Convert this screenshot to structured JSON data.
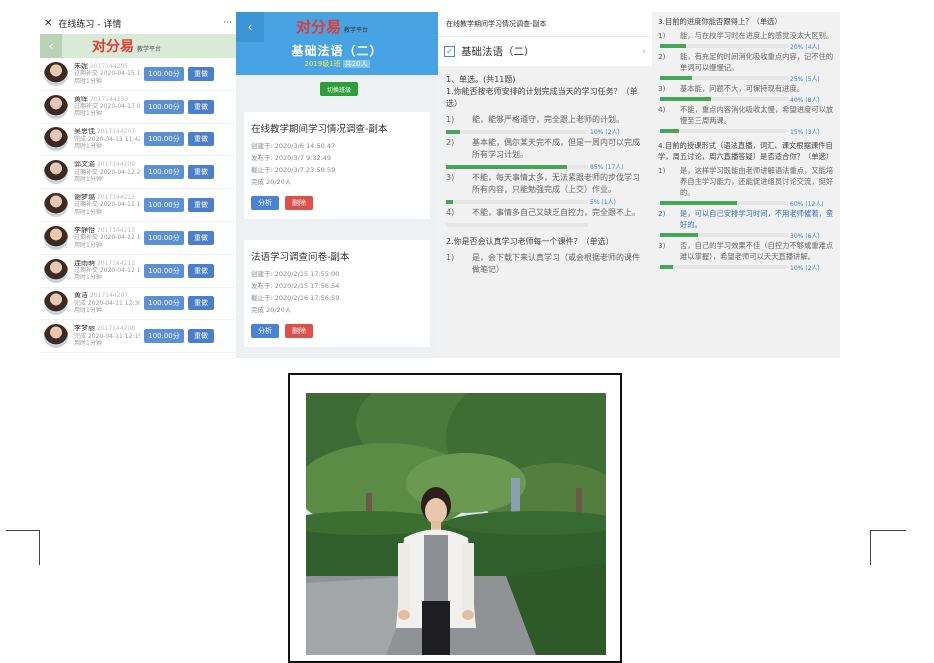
{
  "panel1": {
    "title": "在线练习 - 详情",
    "close": "✕",
    "more": "···",
    "back": "‹",
    "brand": "对分易",
    "brand_sub": "教学平台",
    "score_suffix": "分",
    "redo_label": "重做",
    "students": [
      {
        "name": "朱妮",
        "id": "2017144205",
        "line2": "过期补交 2020-04-15 10:25",
        "line3": "用时1分钟",
        "score": "100.00"
      },
      {
        "name": "黄晖",
        "id": "2017144203",
        "line2": "过期补交 2020-04-17 09:04",
        "line3": "用时1分钟",
        "score": "100.00"
      },
      {
        "name": "吴思佳",
        "id": "2017144207",
        "line2": "完成 2020-04-13 11:42",
        "line3": "用时1分钟",
        "score": "100.00"
      },
      {
        "name": "郭文渝",
        "id": "2017144209",
        "line2": "过期补交 2020-04-12 21:14",
        "line3": "用时1分钟",
        "score": "100.00"
      },
      {
        "name": "谢梦璐",
        "id": "2017144212",
        "line2": "过期补交 2020-04-11 12:11",
        "line3": "用时1分钟",
        "score": "100.00"
      },
      {
        "name": "李静怡",
        "id": "2017144213",
        "line2": "过期补交 2020-04-12 13:35",
        "line3": "用时1分钟",
        "score": "100.00"
      },
      {
        "name": "连雨萌",
        "id": "2017144215",
        "line2": "过期补交 2020-04-12 10:07",
        "line3": "用时1分钟",
        "score": "100.00"
      },
      {
        "name": "黄洁",
        "id": "2017144207",
        "line2": "完成 2020-04-11 12:30",
        "line3": "用时1分钟",
        "score": "100.00"
      },
      {
        "name": "李梦丽",
        "id": "2017144208",
        "line2": "完成 2020-04-11 12:15",
        "line3": "用时1分钟",
        "score": "100.00"
      }
    ]
  },
  "panel2": {
    "back": "‹",
    "brand": "对分易",
    "brand_sub": "教学平台",
    "course": "基础法语（二）",
    "class_name": "2019级1班",
    "count": "共20人",
    "switch_label": "切换班级",
    "cards": [
      {
        "title": "在线教学期间学习情况调查-副本",
        "created": "创建于: 2020/3/6 14:50:47",
        "published": "发布于: 2020/3/7 9:32:49",
        "deadline": "截止于: 2020/3/7 23:59:59",
        "done": "完成 20/20人",
        "analyze": "分析",
        "delete": "删除"
      },
      {
        "title": "法语学习调查问卷-副本",
        "created": "创建于: 2020/2/15 17:55:00",
        "published": "发布于: 2020/2/15 17:56:54",
        "deadline": "截止于: 2020/2/16 17:56:59",
        "done": "完成 20/20人",
        "analyze": "分析",
        "delete": "删除"
      }
    ]
  },
  "panel3": {
    "header": "在线教学期间学习情况调查-副本",
    "course": "基础法语（二）",
    "check": "✓",
    "arrow": "›",
    "section": "1、单选。(共11题)",
    "q1": "1.你能否按老师安排的计划完成当天的学习任务？（单选）",
    "q1_options": [
      {
        "num": "1)",
        "text": "能，能够严格遵守，完全跟上老师的计划。",
        "pct": "10% (2人)",
        "ratio": 0.1
      },
      {
        "num": "2)",
        "text": "基本能，偶尔某天完不成，但是一周内可以完成所有学习计划。",
        "pct": "85% (17人)",
        "ratio": 0.85
      },
      {
        "num": "3)",
        "text": "不能，每天事情太多，无法紧跟老师的步伐学习所有内容，只能勉强完成（上交）作业。",
        "pct": "5% (1人)",
        "ratio": 0.05
      },
      {
        "num": "4)",
        "text": "不能，事情多自己又缺乏自控力，完全跟不上。",
        "pct": "",
        "ratio": 0
      }
    ],
    "q2": "2.你是否会认真学习老师每一个课件？（单选）",
    "q2_options": [
      {
        "num": "1)",
        "text": "是，会下载下来认真学习（或会根据老师的课件做笔记）"
      }
    ]
  },
  "panel4": {
    "q3": "3.目前的进度你能否跟得上？（单选）",
    "q3_options": [
      {
        "num": "1)",
        "text": "能，与在校学习时在进度上的感觉没太大区别。",
        "pct": "20% (4人)",
        "ratio": 0.2
      },
      {
        "num": "2)",
        "text": "能，有充足的时间消化吸收重点内容，记不住的单词可以慢慢记。",
        "pct": "25% (5人)",
        "ratio": 0.25
      },
      {
        "num": "3)",
        "text": "基本能，问题不大，可保持现有进度。",
        "pct": "40% (8人)",
        "ratio": 0.4
      },
      {
        "num": "4)",
        "text": "不能，重点内容消化吸收太慢，希望进度可以放慢至三周两课。",
        "pct": "15% (3人)",
        "ratio": 0.15
      }
    ],
    "q4": "4.目前的授课形式（语法直播，词汇、课文根据课件自学，周五讨论，周六直播答疑）是否适合你？（单选）",
    "q4_options": [
      {
        "num": "1)",
        "text": "是，这样学习既能由老师讲解语法重点，又能培养自主学习能力，还能促进组员讨论交流，挺好的。",
        "pct": "60% (12人)",
        "ratio": 0.6,
        "selected": false
      },
      {
        "num": "2)",
        "text": "是，可以自己安排学习时间，不用老师催着，蛮好的。",
        "pct": "30% (6人)",
        "ratio": 0.3,
        "selected": true
      },
      {
        "num": "3)",
        "text": "否，自己的学习效果不佳（自控力不够或重难点难以掌握），希望老师可以天天直播讲解。",
        "pct": "10% (2人)",
        "ratio": 0.1,
        "selected": false
      }
    ]
  }
}
